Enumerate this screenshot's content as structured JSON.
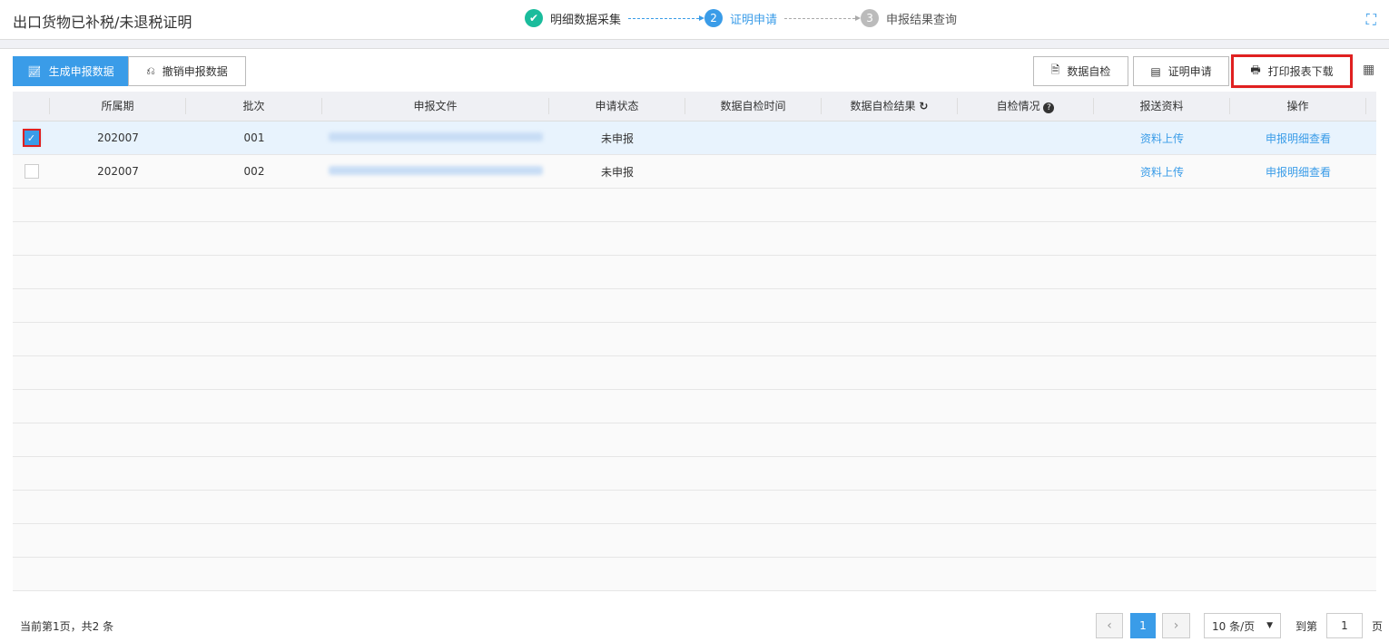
{
  "header": {
    "title": "出口货物已补税/未退税证明",
    "steps": [
      {
        "num": "✔",
        "label": "明细数据采集",
        "color": "#1abc9c"
      },
      {
        "num": "2",
        "label": "证明申请",
        "color": "#3a9ce8"
      },
      {
        "num": "3",
        "label": "申报结果查询",
        "color": "#bbbbbb"
      }
    ]
  },
  "toolbar": {
    "generate": "生成申报数据",
    "revoke": "撤销申报数据",
    "self_check": "数据自检",
    "apply": "证明申请",
    "print": "打印报表下载"
  },
  "table": {
    "columns": [
      "所属期",
      "批次",
      "申报文件",
      "申请状态",
      "数据自检时间",
      "数据自检结果",
      "自检情况",
      "报送资料",
      "操作"
    ],
    "rows": [
      {
        "checked": true,
        "period": "202007",
        "batch": "001",
        "status": "未申报",
        "check_time": "",
        "check_result": "",
        "check_info": "",
        "upload": "资料上传",
        "action": "申报明细查看"
      },
      {
        "checked": false,
        "period": "202007",
        "batch": "002",
        "status": "未申报",
        "check_time": "",
        "check_result": "",
        "check_info": "",
        "upload": "资料上传",
        "action": "申报明细查看"
      }
    ]
  },
  "footer": {
    "summary": "当前第1页，共2 条",
    "current_page": "1",
    "page_size": "10 条/页",
    "goto_label": "到第",
    "goto_value": "1",
    "page_unit": "页"
  }
}
